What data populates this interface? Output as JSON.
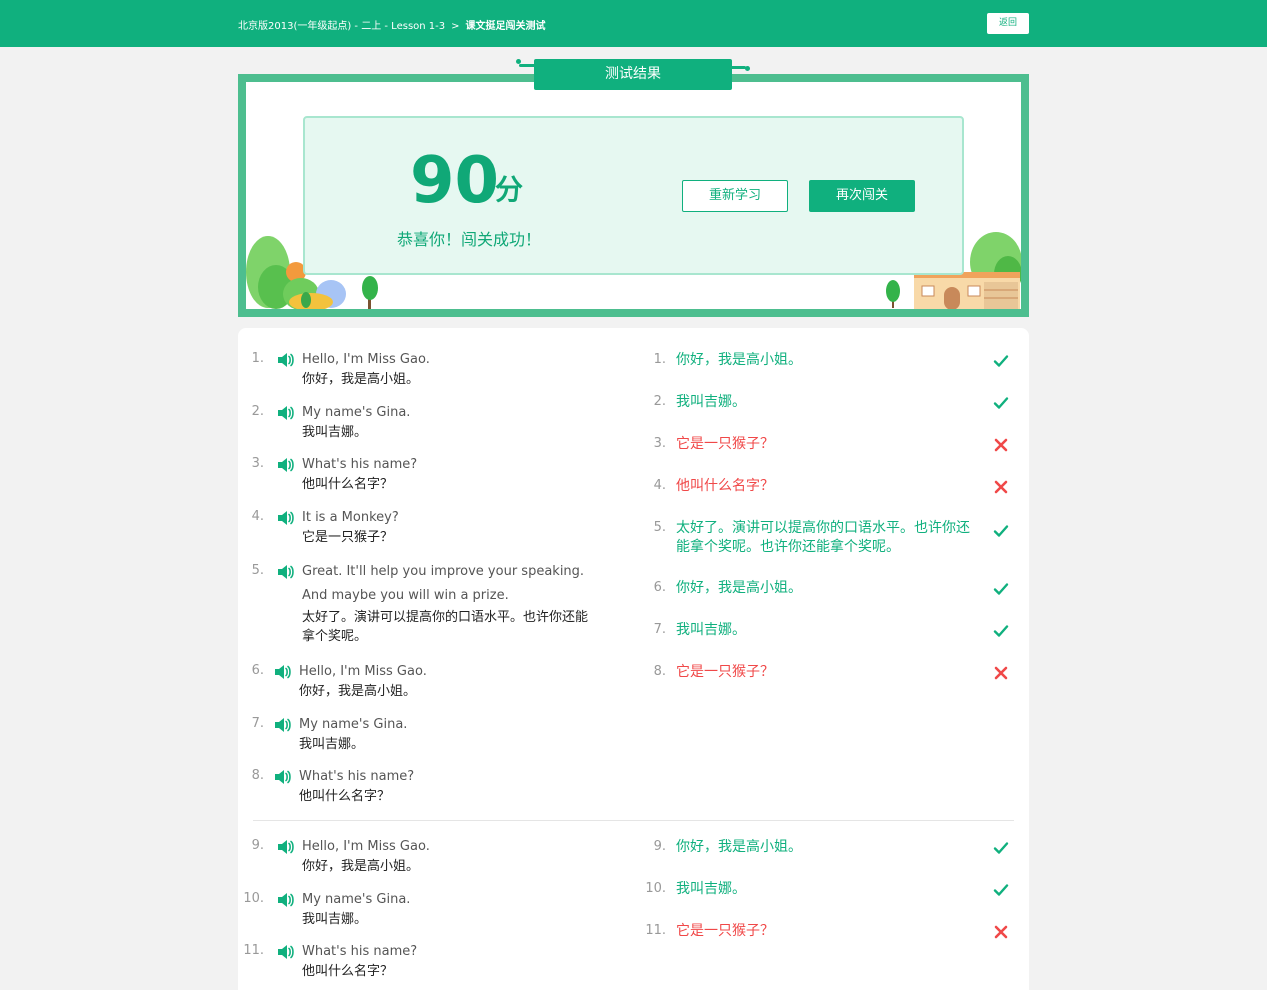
{
  "header": {
    "breadcrumb": "北京版2013(一年级起点) - 二上 - Lesson 1-3",
    "separator": ">",
    "current": "课文挺足闯关测试",
    "back_label": "返回"
  },
  "result": {
    "title": "测试结果",
    "score": "90",
    "unit": "分",
    "message": "恭喜你！闯关成功！",
    "relearn_label": "重新学习",
    "retry_label": "再次闯关"
  },
  "colors": {
    "brand": "#10b07e",
    "correct": "#10b07e",
    "wrong": "#f04848"
  },
  "sentences": [
    {
      "num": "1.",
      "en": "Hello, I'm Miss Gao.",
      "zh": "你好，我是高小姐。"
    },
    {
      "num": "2.",
      "en": "My name's Gina.",
      "zh": "我叫吉娜。"
    },
    {
      "num": "3.",
      "en": "What's his name?",
      "zh": "他叫什么名字？"
    },
    {
      "num": "4.",
      "en": "It is a Monkey?",
      "zh": "它是一只猴子？"
    },
    {
      "num": "5.",
      "en": "Great. It'll help you improve your speaking.",
      "en2": "And maybe you will win a prize.",
      "zh": "太好了。演讲可以提高你的口语水平。也许你还能拿个奖呢。"
    },
    {
      "num": "6.",
      "en": "Hello, I'm Miss Gao.",
      "zh": "你好，我是高小姐。"
    },
    {
      "num": "7.",
      "en": "My name's Gina.",
      "zh": "我叫吉娜。"
    },
    {
      "num": "8.",
      "en": "What's his name?",
      "zh": "他叫什么名字？"
    },
    {
      "num": "9.",
      "en": "Hello, I'm Miss Gao.",
      "zh": "你好，我是高小姐。"
    },
    {
      "num": "10.",
      "en": "My name's Gina.",
      "zh": "我叫吉娜。"
    },
    {
      "num": "11.",
      "en": "What's his name?",
      "zh": "他叫什么名字？"
    }
  ],
  "answers": [
    {
      "num": "1.",
      "text": "你好，我是高小姐。",
      "status": "correct",
      "icon": "check-icon"
    },
    {
      "num": "2.",
      "text": "我叫吉娜。",
      "status": "correct",
      "icon": "check-icon"
    },
    {
      "num": "3.",
      "text": "它是一只猴子？",
      "status": "wrong",
      "icon": "cross-icon"
    },
    {
      "num": "4.",
      "text": "他叫什么名字？",
      "status": "wrong",
      "icon": "cross-icon"
    },
    {
      "num": "5.",
      "text": "太好了。演讲可以提高你的口语水平。也许你还能拿个奖呢。也许你还能拿个奖呢。",
      "status": "correct",
      "icon": "check-icon"
    },
    {
      "num": "6.",
      "text": "你好，我是高小姐。",
      "status": "correct",
      "icon": "check-icon"
    },
    {
      "num": "7.",
      "text": "我叫吉娜。",
      "status": "correct",
      "icon": "check-icon"
    },
    {
      "num": "8.",
      "text": "它是一只猴子？",
      "status": "wrong",
      "icon": "cross-icon"
    },
    {
      "num": "9.",
      "text": "你好，我是高小姐。",
      "status": "correct",
      "icon": "check-icon"
    },
    {
      "num": "10.",
      "text": "我叫吉娜。",
      "status": "correct",
      "icon": "check-icon"
    },
    {
      "num": "11.",
      "text": "它是一只猴子？",
      "status": "wrong",
      "icon": "cross-icon"
    }
  ]
}
